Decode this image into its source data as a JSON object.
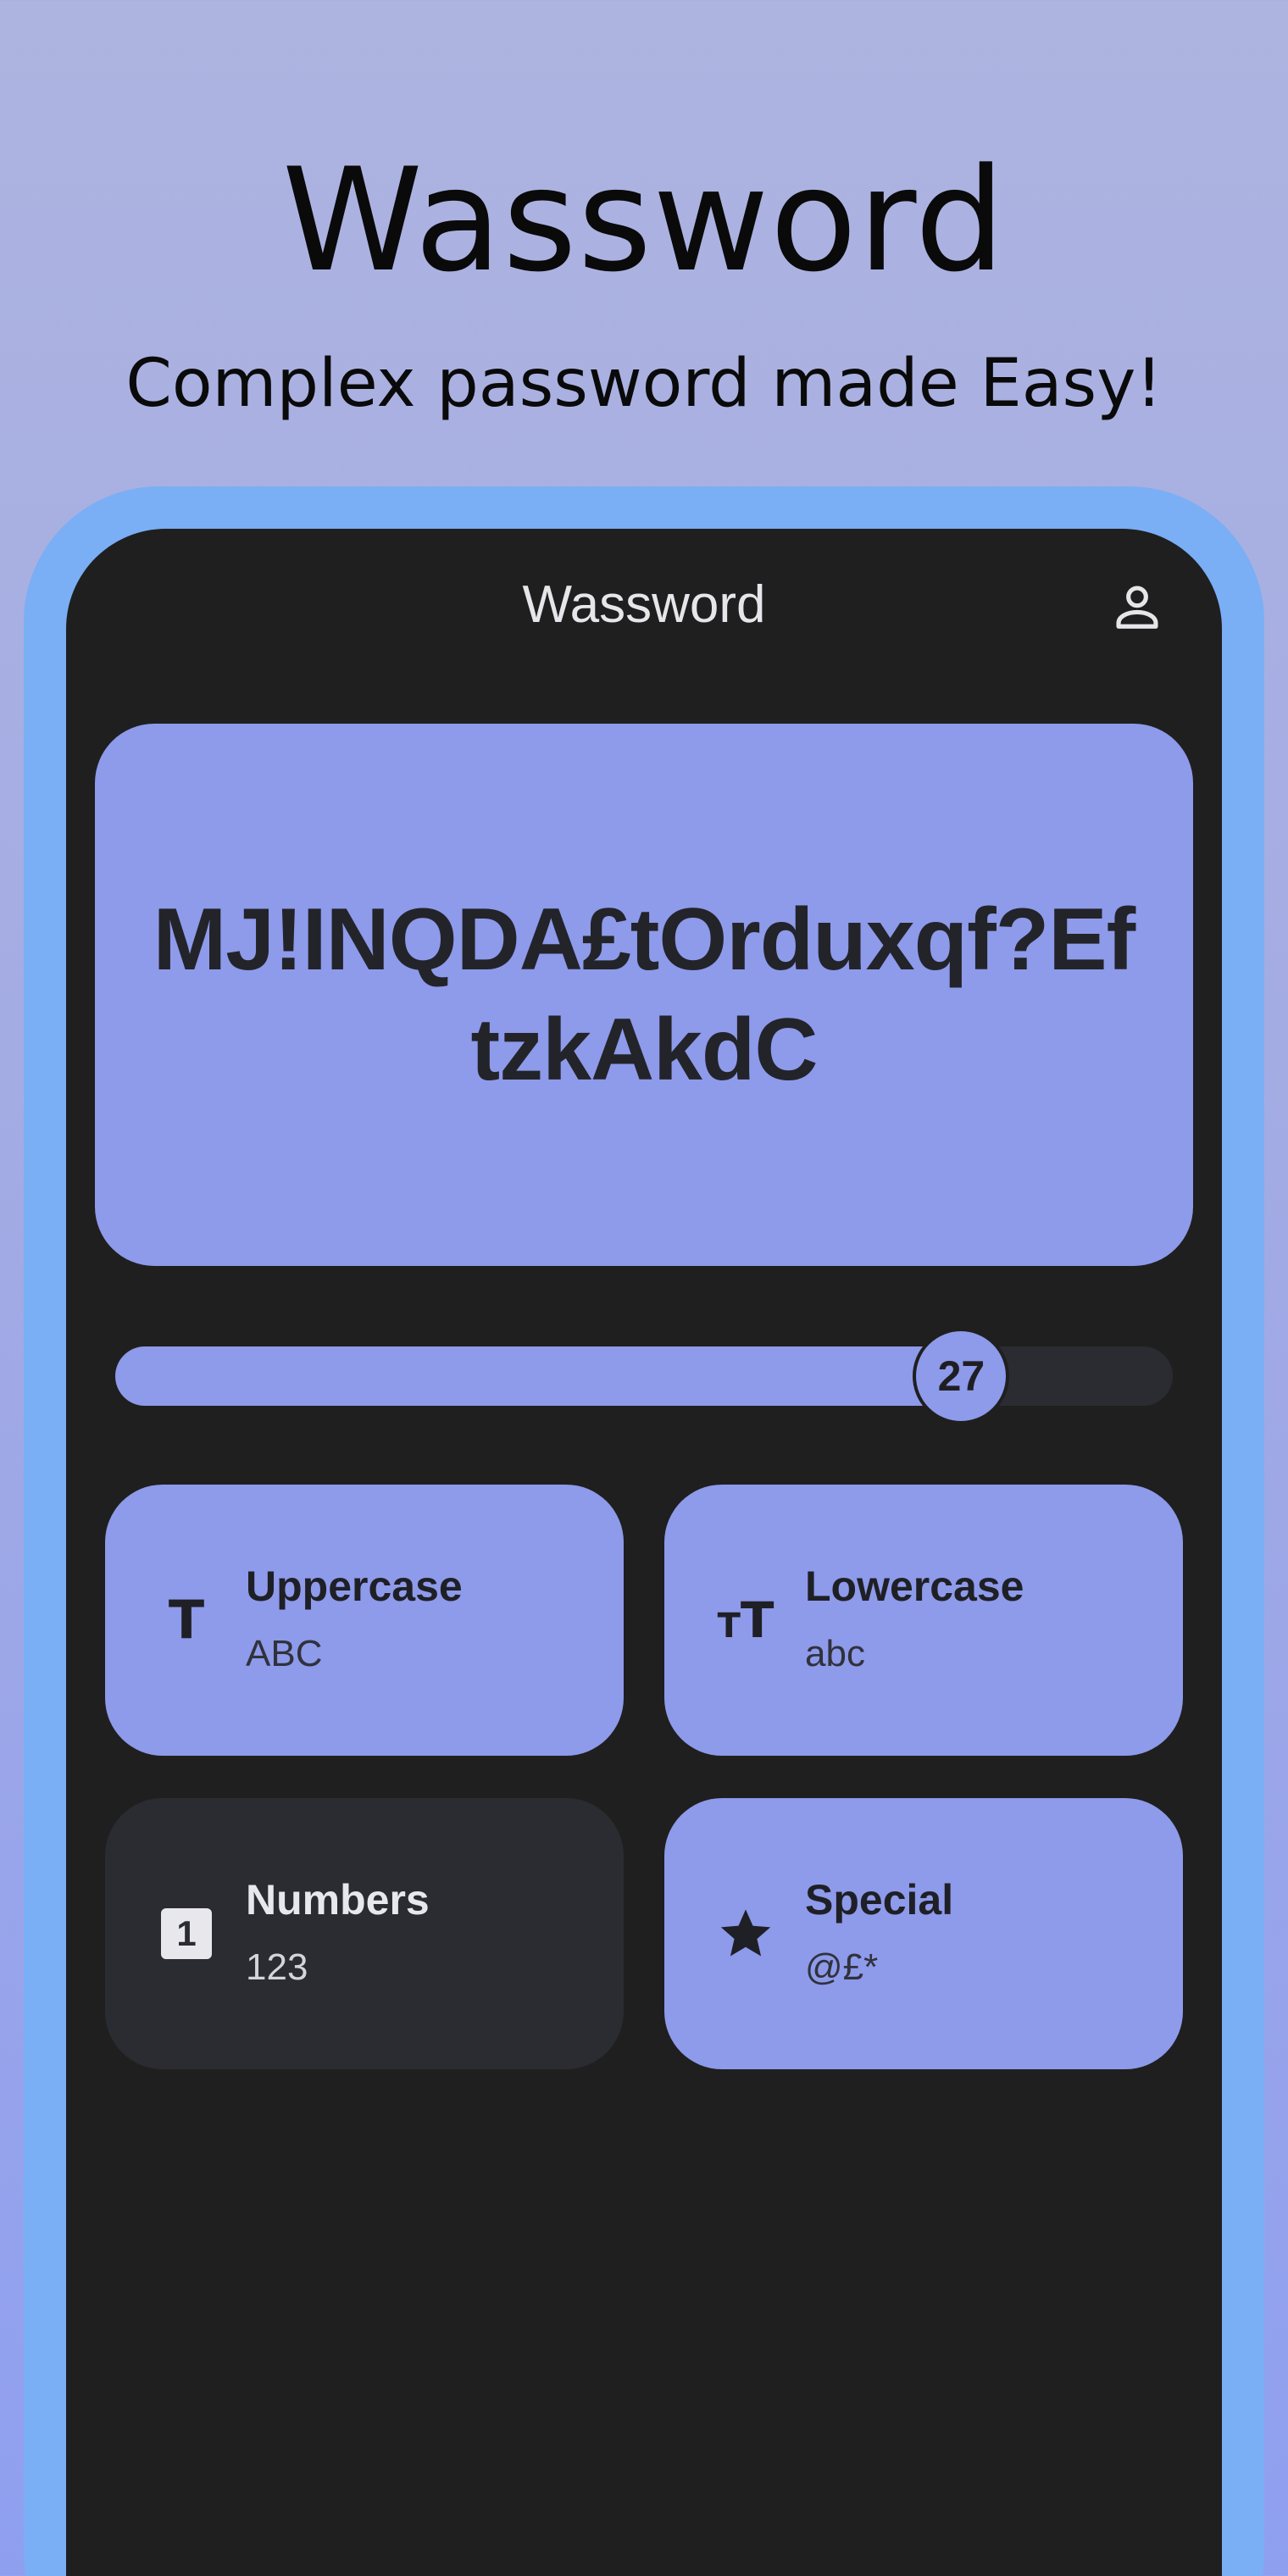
{
  "hero": {
    "title": "Wassword",
    "subtitle": "Complex password made Easy!"
  },
  "app": {
    "title": "Wassword",
    "profile_icon": "person-outline-icon",
    "password": "MJ!INQDA£tOrduxqf?EftzkAkdC",
    "length": {
      "value": "27",
      "fraction": 0.8
    },
    "options": [
      {
        "id": "uppercase",
        "label": "Uppercase",
        "sample": "ABC",
        "icon": "uppercase-t-icon",
        "selected": true
      },
      {
        "id": "lowercase",
        "label": "Lowercase",
        "sample": "abc",
        "icon": "text-size-icon",
        "selected": true
      },
      {
        "id": "numbers",
        "label": "Numbers",
        "sample": "123",
        "icon": "number-one-box-icon",
        "selected": false
      },
      {
        "id": "special",
        "label": "Special",
        "sample": "@£*",
        "icon": "star-icon",
        "selected": true
      }
    ]
  },
  "colors": {
    "accent": "#8e9aea",
    "frame": "#7aaef5",
    "surface": "#1f1f1f",
    "card_off": "#2b2c31"
  }
}
